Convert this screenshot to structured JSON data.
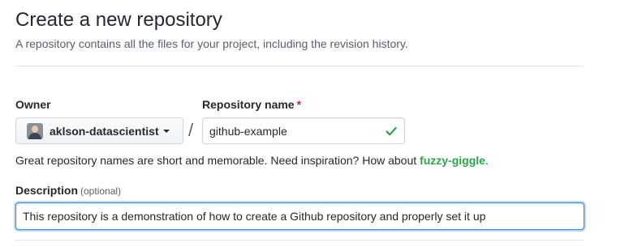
{
  "header": {
    "title": "Create a new repository",
    "subtitle": "A repository contains all the files for your project, including the revision history."
  },
  "owner": {
    "label": "Owner",
    "selected": "aklson-datascientist",
    "avatar_icon": "avatar",
    "dropdown_icon": "caret-down-icon"
  },
  "separator": "/",
  "repository": {
    "label": "Repository name",
    "required_marker": "*",
    "value": "github-example",
    "valid_icon": "check-icon",
    "valid_color": "#28a745"
  },
  "hint": {
    "text": "Great repository names are short and memorable. Need inspiration? How about ",
    "suggestion": "fuzzy-giggle",
    "suffix": "."
  },
  "description": {
    "label": "Description",
    "optional_note": "(optional)",
    "value": "This repository is a demonstration of how to create a Github repository and properly set it up"
  },
  "colors": {
    "required": "#cb2431",
    "suggestion": "#28a745",
    "focus_border": "#2188ff"
  }
}
